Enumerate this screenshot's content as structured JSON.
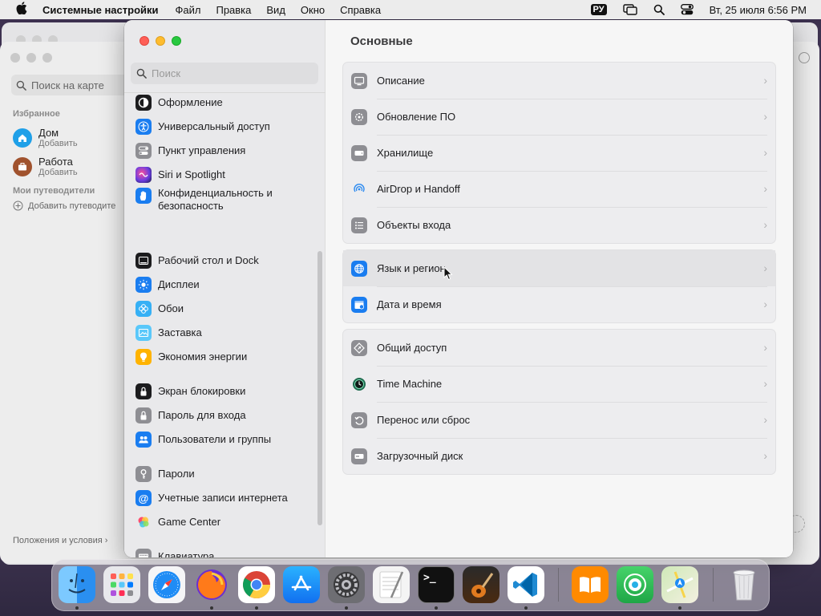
{
  "menubar": {
    "app_name": "Системные настройки",
    "menus": [
      "Файл",
      "Правка",
      "Вид",
      "Окно",
      "Справка"
    ],
    "input_source": "РУ",
    "clock": "Вт, 25 июля  6:56 PM"
  },
  "maps": {
    "search_placeholder": "Поиск на карте",
    "favorites_header": "Избранное",
    "home_title": "Дом",
    "home_sub": "Добавить",
    "work_title": "Работа",
    "work_sub": "Добавить",
    "guides_header": "Мои путеводители",
    "add_guide": "Добавить путеводите",
    "terms": "Положения и условия"
  },
  "sidebar": {
    "search_placeholder": "Поиск",
    "items": [
      {
        "label": "Оформление",
        "icon": "appearance-icon",
        "color": "#1c1c1e"
      },
      {
        "label": "Универсальный доступ",
        "icon": "accessibility-icon",
        "color": "#1a7df0"
      },
      {
        "label": "Пункт управления",
        "icon": "control-center-icon",
        "color": "#8e8e93"
      },
      {
        "label": "Siri и Spotlight",
        "icon": "siri-icon",
        "color": "#6a3de0"
      },
      {
        "label": "Конфиденциальность и безопасность",
        "icon": "privacy-hand-icon",
        "color": "#1a7df0"
      },
      {
        "label": "Рабочий стол и Dock",
        "icon": "desktop-dock-icon",
        "color": "#1c1c1e"
      },
      {
        "label": "Дисплеи",
        "icon": "display-icon",
        "color": "#1a7df0"
      },
      {
        "label": "Обои",
        "icon": "wallpaper-icon",
        "color": "#36b0f5"
      },
      {
        "label": "Заставка",
        "icon": "screensaver-icon",
        "color": "#5ac8fa"
      },
      {
        "label": "Экономия энергии",
        "icon": "energy-icon",
        "color": "#ffb300"
      },
      {
        "label": "Экран блокировки",
        "icon": "lock-screen-icon",
        "color": "#1c1c1e"
      },
      {
        "label": "Пароль для входа",
        "icon": "login-password-icon",
        "color": "#8e8e93"
      },
      {
        "label": "Пользователи и группы",
        "icon": "users-icon",
        "color": "#1a7df0"
      },
      {
        "label": "Пароли",
        "icon": "key-icon",
        "color": "#8e8e93"
      },
      {
        "label": "Учетные записи интернета",
        "icon": "internet-accounts-icon",
        "color": "#1a7df0"
      },
      {
        "label": "Game Center",
        "icon": "game-center-icon",
        "color": "#ffffff"
      },
      {
        "label": "Клавиатура",
        "icon": "keyboard-icon",
        "color": "#8e8e93"
      }
    ]
  },
  "content": {
    "title": "Основные",
    "groups": [
      [
        {
          "label": "Описание",
          "icon": "about-icon",
          "color": "#8e8e93"
        },
        {
          "label": "Обновление ПО",
          "icon": "software-update-icon",
          "color": "#8e8e93"
        },
        {
          "label": "Хранилище",
          "icon": "storage-icon",
          "color": "#8e8e93"
        },
        {
          "label": "AirDrop и Handoff",
          "icon": "airdrop-icon",
          "color": "#ffffff"
        },
        {
          "label": "Объекты входа",
          "icon": "login-items-icon",
          "color": "#8e8e93"
        }
      ],
      [
        {
          "label": "Язык и регион",
          "icon": "globe-icon",
          "color": "#1a7df0"
        },
        {
          "label": "Дата и время",
          "icon": "date-time-icon",
          "color": "#1a7df0"
        }
      ],
      [
        {
          "label": "Общий доступ",
          "icon": "sharing-icon",
          "color": "#8e8e93"
        },
        {
          "label": "Time Machine",
          "icon": "time-machine-icon",
          "color": "#1f6b4f"
        },
        {
          "label": "Перенос или сброс",
          "icon": "transfer-reset-icon",
          "color": "#8e8e93"
        },
        {
          "label": "Загрузочный диск",
          "icon": "startup-disk-icon",
          "color": "#8e8e93"
        }
      ]
    ]
  },
  "dock": {
    "apps": [
      {
        "name": "Finder",
        "icon": "finder-icon",
        "color": "#2a8ff0",
        "running": true
      },
      {
        "name": "Launchpad",
        "icon": "launchpad-icon",
        "color": "#e8e8ec",
        "running": false
      },
      {
        "name": "Safari",
        "icon": "safari-icon",
        "color": "#1f8cf5",
        "running": false
      },
      {
        "name": "Firefox",
        "icon": "firefox-icon",
        "color": "#6b2fd1",
        "running": true
      },
      {
        "name": "Chrome",
        "icon": "chrome-icon",
        "color": "#ffffff",
        "running": true
      },
      {
        "name": "App Store",
        "icon": "app-store-icon",
        "color": "#1c8cf3",
        "running": false
      },
      {
        "name": "System Settings",
        "icon": "settings-gear-icon",
        "color": "#6e6e73",
        "running": true
      },
      {
        "name": "TextEdit",
        "icon": "textedit-icon",
        "color": "#f4f4f4",
        "running": false
      },
      {
        "name": "Terminal",
        "icon": "terminal-icon",
        "color": "#111111",
        "running": true
      },
      {
        "name": "GarageBand",
        "icon": "garageband-icon",
        "color": "#7a4a1e",
        "running": false
      },
      {
        "name": "VS Code",
        "icon": "vscode-icon",
        "color": "#ffffff",
        "running": true
      },
      {
        "name": "Books",
        "icon": "books-icon",
        "color": "#ff8a00",
        "running": false
      },
      {
        "name": "Find My",
        "icon": "find-my-icon",
        "color": "#2fbf4f",
        "running": false
      },
      {
        "name": "Maps",
        "icon": "maps-icon",
        "color": "#e8f4e0",
        "running": true
      },
      {
        "name": "Trash",
        "icon": "trash-icon",
        "color": "#e6e6e9",
        "running": false
      }
    ],
    "terminal_glyph": ">_"
  }
}
